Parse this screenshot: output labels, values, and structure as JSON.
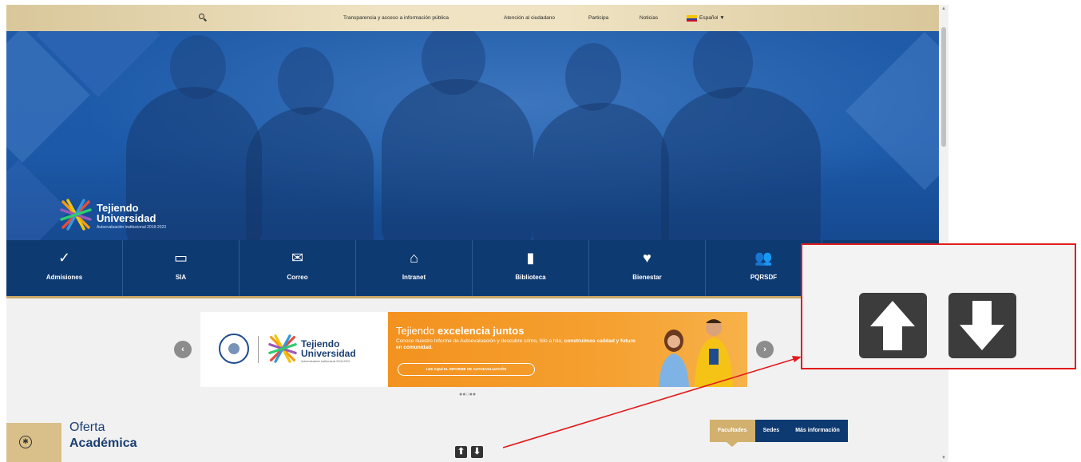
{
  "topbar": {
    "links": [
      "Transparencia y acceso a información pública",
      "Atención al ciudadano",
      "Participa",
      "Noticias"
    ],
    "language": "Español ▼",
    "search_icon": "search-icon"
  },
  "hero": {
    "brand_line1": "Tejiendo",
    "brand_line2": "Universidad",
    "brand_sub": "Autoevaluación institucional 2018-2023"
  },
  "nav": {
    "tiles": [
      {
        "label": "Admisiones",
        "icon": "✓"
      },
      {
        "label": "SIA",
        "icon": "▭"
      },
      {
        "label": "Correo",
        "icon": "✉"
      },
      {
        "label": "Intranet",
        "icon": "⌂"
      },
      {
        "label": "Biblioteca",
        "icon": "▮"
      },
      {
        "label": "Bienestar",
        "icon": "♥"
      },
      {
        "label": "PQRSDF",
        "icon": "👥"
      }
    ]
  },
  "carousel": {
    "prev_icon": "‹",
    "next_icon": "›",
    "logo_line1": "Tejiendo",
    "logo_line2": "Universidad",
    "logo_sub": "Autoevaluación institucional 2018-2023",
    "headline_pre": "Tejiendo ",
    "headline_bold": "excelencia juntos",
    "body_pre": "Conoce nuestro Informe de Autoevaluación y descubre cómo, hilo a hilo, ",
    "body_bold": "construimos calidad y futuro en comunidad.",
    "cta": "LEE AQUÍ EL INFORME DE AUTOEVALUACIÓN",
    "dots": "●●○●●"
  },
  "oferta": {
    "title_line1": "Oferta",
    "title_line2": "Académica",
    "tabs": [
      "Facultades",
      "Sedes",
      "Más información"
    ],
    "accessibility_icon": "accessibility-icon"
  },
  "scroll_buttons": {
    "up": "⬆",
    "down": "⬇"
  },
  "colors": {
    "navy": "#0e3a72",
    "gold": "#d2b06d",
    "hero_blue": "#1c5aa9",
    "orange": "#f3921f",
    "callout_border": "#e21b1b"
  }
}
